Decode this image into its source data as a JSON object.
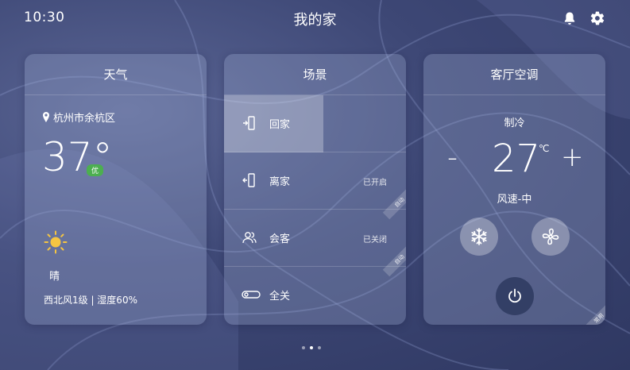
{
  "status": {
    "time": "10:30",
    "title": "我的家"
  },
  "weather": {
    "header": "天气",
    "location": "杭州市余杭区",
    "temperature": "37°",
    "aqi": "优",
    "condition": "晴",
    "wind_humidity": "西北风1级 | 湿度60%"
  },
  "scenes": {
    "header": "场景",
    "items": [
      {
        "label": "回家",
        "status": "",
        "tag": "",
        "icon": "door-enter-icon",
        "selected": true
      },
      {
        "label": "离家",
        "status": "已开启",
        "tag": "自动",
        "icon": "door-exit-icon",
        "selected": false
      },
      {
        "label": "会客",
        "status": "已关闭",
        "tag": "自动",
        "icon": "guests-icon",
        "selected": false
      },
      {
        "label": "全关",
        "status": "",
        "tag": "",
        "icon": "toggle-off-icon",
        "selected": false
      }
    ]
  },
  "ac": {
    "header": "客厅空调",
    "mode": "制冷",
    "minus": "-",
    "temperature": "27",
    "unit": "℃",
    "plus": "+",
    "fan_speed": "风速-中",
    "tag": "常用"
  },
  "pagination": {
    "count": 3,
    "active": 1
  }
}
